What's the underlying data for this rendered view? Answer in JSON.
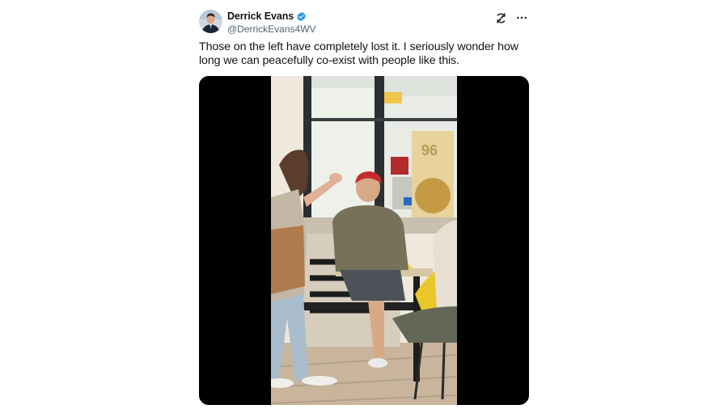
{
  "author": {
    "display_name": "Derrick Evans",
    "handle": "@DerrickEvans4WV",
    "verified": true,
    "verified_color": "#1d9bf0"
  },
  "post": {
    "text": "Those on the left have completely lost it. I seriously wonder how long we can peacefully co-exist with people like this."
  },
  "actions": {
    "refresh_icon": "refresh-icon",
    "more_icon": "more-options-icon"
  },
  "media": {
    "type": "video-frame",
    "background": "#000000"
  }
}
